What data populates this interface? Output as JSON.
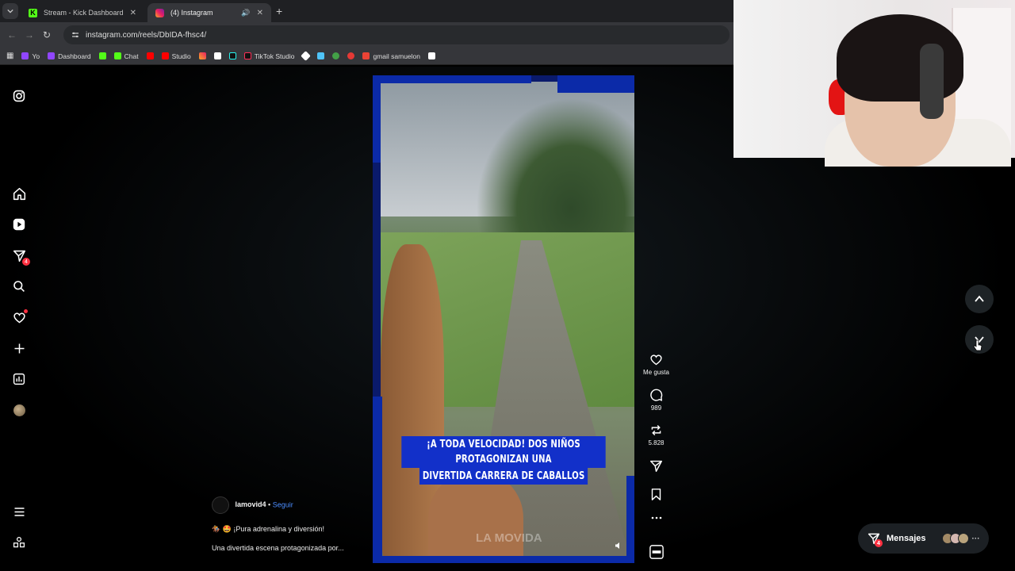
{
  "browser": {
    "tabs": [
      {
        "title": "Stream - Kick Dashboard",
        "close": "✕"
      },
      {
        "title": "(4) Instagram",
        "close": "✕"
      }
    ],
    "new_tab": "+",
    "url": "instagram.com/reels/DbIDA-fhsc4/",
    "bookmarks": [
      "Yo",
      "Dashboard",
      "Chat",
      "Studio",
      "TikTok Studio",
      "gmail samuelon"
    ]
  },
  "sidebar": {
    "notifications_badge": "4"
  },
  "reel": {
    "caption_line1": "¡A TODA VELOCIDAD! DOS NIÑOS PROTAGONIZAN UNA",
    "caption_line2": "DIVERTIDA CARRERA DE CABALLOS",
    "watermark": "LA MOVIDA"
  },
  "actions": {
    "like_label": "Me gusta",
    "comments_count": "989",
    "reposts_count": "5.828"
  },
  "author": {
    "handle": "lamovid4",
    "separator": "•",
    "follow_label": "Seguir",
    "desc_line1": "🏇 🤩 ¡Pura adrenalina y diversión!",
    "desc_line2": "Una divertida escena protagonizada por..."
  },
  "messages": {
    "label": "Mensajes",
    "badge": "4",
    "more": "···"
  },
  "colors": {
    "accent_blue": "#4c8dff",
    "badge_red": "#ff3040",
    "caption_bg": "#1230c9"
  }
}
